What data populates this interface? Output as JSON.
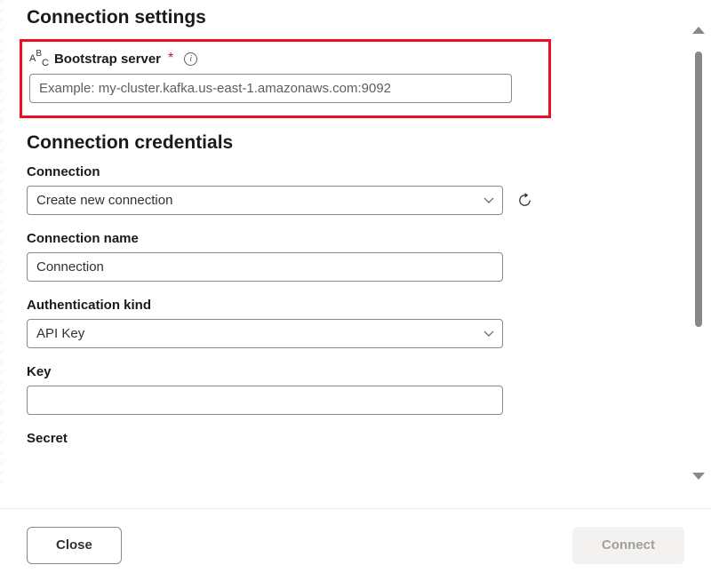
{
  "settings": {
    "title": "Connection settings",
    "bootstrap": {
      "label": "Bootstrap server",
      "placeholder": "Example: my-cluster.kafka.us-east-1.amazonaws.com:9092",
      "value": ""
    }
  },
  "credentials": {
    "title": "Connection credentials",
    "connection": {
      "label": "Connection",
      "selected": "Create new connection"
    },
    "connection_name": {
      "label": "Connection name",
      "value": "Connection"
    },
    "auth_kind": {
      "label": "Authentication kind",
      "selected": "API Key"
    },
    "key": {
      "label": "Key",
      "value": ""
    },
    "secret": {
      "label": "Secret"
    }
  },
  "footer": {
    "close": "Close",
    "connect": "Connect"
  }
}
